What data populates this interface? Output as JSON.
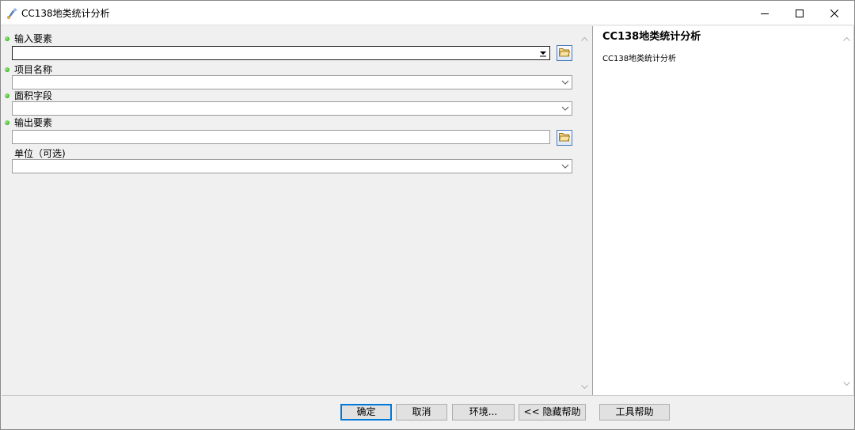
{
  "window": {
    "title": "CC138地类统计分析",
    "app_icon": "arcgis-tool-icon",
    "controls": {
      "minimize_icon": "minimize-icon",
      "maximize_icon": "maximize-icon",
      "close_icon": "close-icon"
    }
  },
  "form": {
    "fields": [
      {
        "label": "输入要素",
        "required": true,
        "type": "dropdown-with-browse",
        "value": "",
        "icon": "folder-open-icon"
      },
      {
        "label": "项目名称",
        "required": true,
        "type": "dropdown",
        "value": ""
      },
      {
        "label": "面积字段",
        "required": true,
        "type": "dropdown",
        "value": ""
      },
      {
        "label": "输出要素",
        "required": true,
        "type": "text-with-browse",
        "value": "",
        "icon": "folder-open-icon"
      },
      {
        "label": "单位（可选)",
        "required": false,
        "type": "dropdown",
        "value": ""
      }
    ],
    "required_dot_color": "#2fae1d"
  },
  "help": {
    "title": "CC138地类统计分析",
    "body": "CC138地类统计分析"
  },
  "buttons": {
    "ok": "确定",
    "cancel": "取消",
    "environments": "环境...",
    "hide_help": "<< 隐藏帮助",
    "tool_help": "工具帮助"
  },
  "colors": {
    "accent": "#0078d7",
    "background": "#f0f0f0"
  }
}
